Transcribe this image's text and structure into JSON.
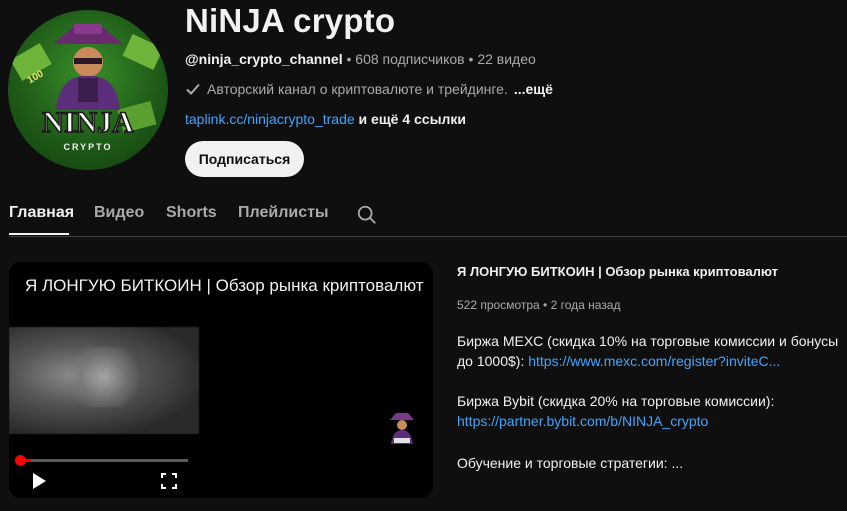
{
  "channel": {
    "avatar_text": "NINJA",
    "avatar_subtext": "CRYPTO",
    "avatar_badge": "100",
    "title": "NiNJA crypto",
    "handle": "@ninja_crypto_channel",
    "sep1": " • ",
    "subscribers": "608 подписчиков",
    "sep2": " • ",
    "videos": "22 видео",
    "description": "Авторский канал о криптовалюте и трейдинге.",
    "description_more": "...ещё",
    "link": "taplink.cc/ninjacrypto_trade",
    "links_more": " и ещё 4 ссылки",
    "subscribe_label": "Подписаться"
  },
  "tabs": [
    {
      "label": "Главная",
      "active": true
    },
    {
      "label": "Видео",
      "active": false
    },
    {
      "label": "Shorts",
      "active": false
    },
    {
      "label": "Плейлисты",
      "active": false
    }
  ],
  "player": {
    "title": "Я ЛОНГУЮ БИТКОИН | Обзор рынка криптовалют",
    "progress": 0.07
  },
  "video_info": {
    "title": "Я ЛОНГУЮ БИТКОИН | Обзор рынка криптовалют",
    "views": "522 просмотра",
    "sep": " • ",
    "age": "2 года назад",
    "desc1_text": "Биржа MEXC (скидка 10% на торговые комиссии и бонусы до 1000$): ",
    "desc1_link": "https://www.mexc.com/register?inviteC...",
    "desc2_text": "Биржа Bybit (скидка 20% на торговые комиссии):",
    "desc2_link": "https://partner.bybit.com/b/NINJA_crypto",
    "desc3_text": "Обучение и торговые стратегии: ..."
  },
  "colors": {
    "background": "#0f0f0f",
    "link": "#3ea6ff",
    "progress": "#ff0000"
  }
}
